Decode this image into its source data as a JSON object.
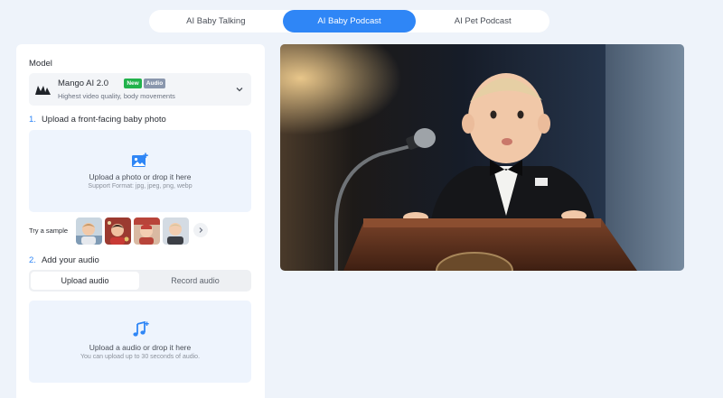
{
  "tabs": [
    {
      "label": "AI Baby Talking"
    },
    {
      "label": "AI Baby Podcast"
    },
    {
      "label": "AI Pet Podcast"
    }
  ],
  "model": {
    "label": "Model",
    "name": "Mango AI 2.0",
    "badge_new": "New",
    "badge_audio": "Audio",
    "description": "Highest video quality, body movements"
  },
  "step1": {
    "number": "1.",
    "title": "Upload a front-facing baby photo",
    "drop_title": "Upload a photo or drop it here",
    "drop_sub": "Support Format: jpg, jpeg, png, webp"
  },
  "samples": {
    "label": "Try a sample"
  },
  "step2": {
    "number": "2.",
    "title": "Add your audio",
    "upload_tab": "Upload audio",
    "record_tab": "Record audio",
    "drop_title": "Upload a audio or drop it here",
    "drop_sub": "You can upload up to 30 seconds of audio."
  },
  "colors": {
    "accent": "#2f86f6",
    "new_badge": "#22b24c",
    "audio_badge": "#8a97ad"
  }
}
